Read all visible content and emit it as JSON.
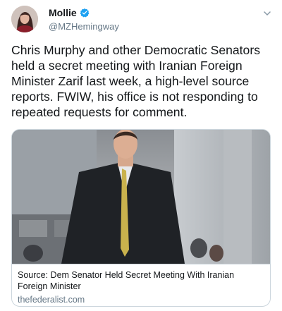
{
  "tweet": {
    "author_name": "Mollie",
    "author_handle": "@MZHemingway",
    "text": "Chris Murphy and other Democratic Senators held a secret meeting with Iranian Foreign Minister Zarif last week, a high-level source reports. FWIW, his office is not responding to repeated requests for comment.",
    "verified_icon": "verified-badge-icon",
    "menu_icon": "chevron-down-icon"
  },
  "card": {
    "title": "Source: Dem Senator Held Secret Meeting With Iranian Foreign Minister",
    "domain": "thefederalist.com"
  },
  "colors": {
    "text": "#14171a",
    "secondary": "#657786",
    "verified": "#1da1f2",
    "border": "#ccd6dd"
  }
}
